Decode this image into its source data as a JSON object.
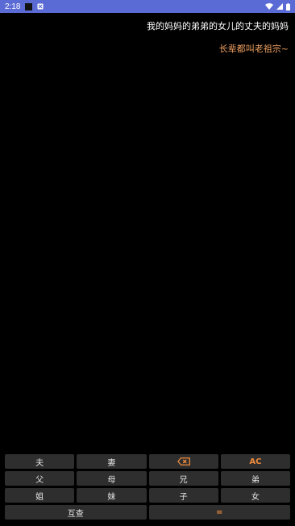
{
  "status_bar": {
    "time": "2:18",
    "icons": [
      "notification-square-icon",
      "app-notification-icon",
      "wifi-icon",
      "cell-signal-icon",
      "battery-icon"
    ]
  },
  "display": {
    "expression": "我的妈妈的弟弟的女儿的丈夫的妈妈",
    "result": "长辈都叫老祖宗~"
  },
  "keypad": {
    "husband": "夫",
    "wife": "妻",
    "backspace_icon": "backspace-icon",
    "clear": "AC",
    "father": "父",
    "mother": "母",
    "elder_brother": "兄",
    "younger_brother": "弟",
    "elder_sister": "姐",
    "younger_sister": "妹",
    "son": "子",
    "daughter": "女",
    "mutual": "互查",
    "equals": "="
  },
  "colors": {
    "status_bar": "#5b6bd6",
    "background": "#000000",
    "key_bg": "#2e2e2e",
    "accent": "#f08b3a",
    "result_text": "#f0a060"
  }
}
